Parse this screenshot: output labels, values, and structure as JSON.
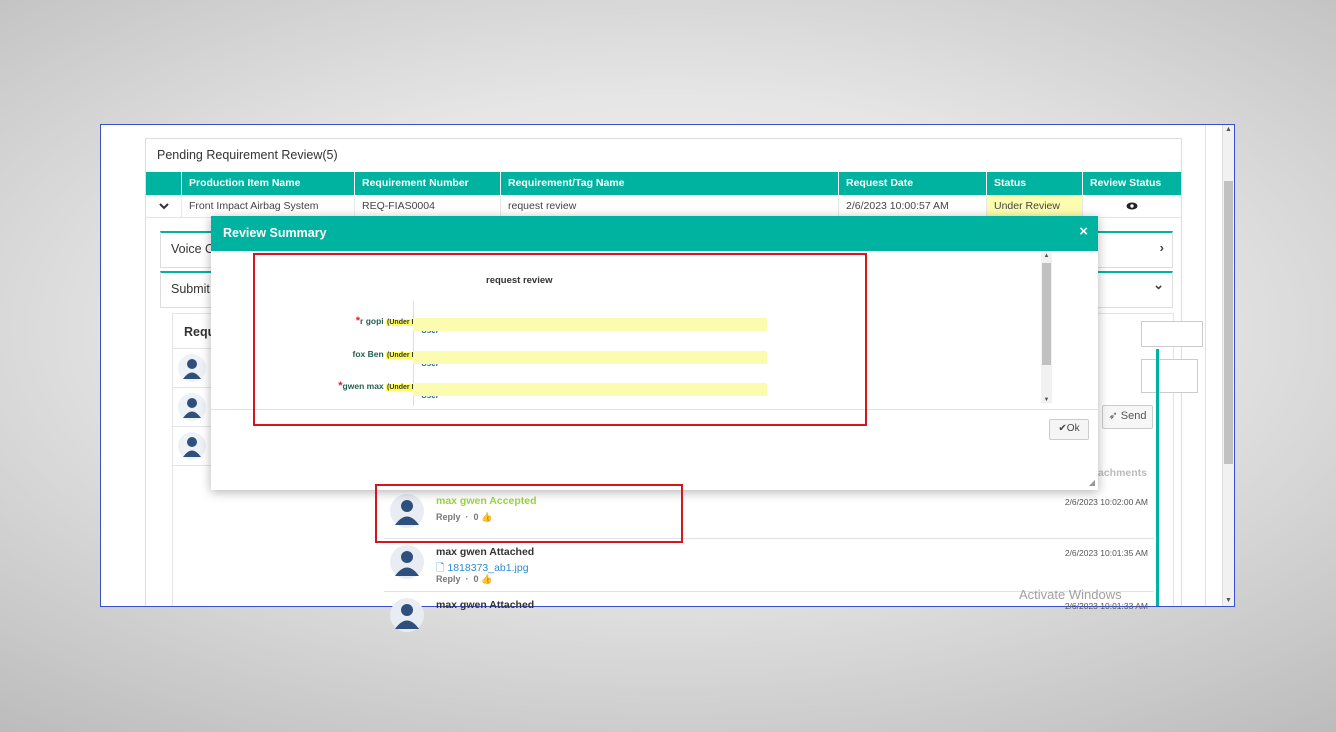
{
  "panel": {
    "title": "Pending Requirement Review(5)"
  },
  "table": {
    "headers": [
      "Production Item Name",
      "Requirement Number",
      "Requirement/Tag Name",
      "Request Date",
      "Status",
      "Review Status"
    ],
    "row": {
      "production_item": "Front Impact Airbag System",
      "requirement_number": "REQ-FIAS0004",
      "tag_name": "request review",
      "request_date": "2/6/2023 10:00:57 AM",
      "status": "Under Review",
      "review_icon": "eye-icon"
    }
  },
  "accordions": [
    {
      "title": "Voice O",
      "chevron": "›"
    },
    {
      "title": "Submit",
      "chevron": "⌄"
    }
  ],
  "submit": {
    "header": "Requ"
  },
  "send_label": "Send",
  "attachments_label": "achments",
  "modal": {
    "title": "Review Summary",
    "close": "×",
    "heading": "request review",
    "reviewers": [
      {
        "required": "*",
        "name": "r gopi",
        "status": "(Under Review)",
        "role": "User"
      },
      {
        "required": "",
        "name": "fox Ben",
        "status": "(Under Review)",
        "role": "User"
      },
      {
        "required": "*",
        "name": "gwen max",
        "status": "(Under Review)",
        "role": "User"
      }
    ],
    "ok_label": "Ok"
  },
  "feed": [
    {
      "who": "max gwen Accepted",
      "time": "2/6/2023 10:02:00 AM",
      "reply": "Reply",
      "likes": "0"
    },
    {
      "who": "max gwen Attached",
      "file": "1818373_ab1.jpg",
      "time": "2/6/2023 10:01:35 AM",
      "reply": "Reply",
      "likes": "0"
    },
    {
      "who": "max gwen Attached",
      "time": "2/6/2023 10:01:33 AM"
    }
  ],
  "watermark": "Activate Windows",
  "colors": {
    "accent": "#00b3a1",
    "highlight": "#d6161e",
    "status_bg": "#fdfdb0"
  }
}
